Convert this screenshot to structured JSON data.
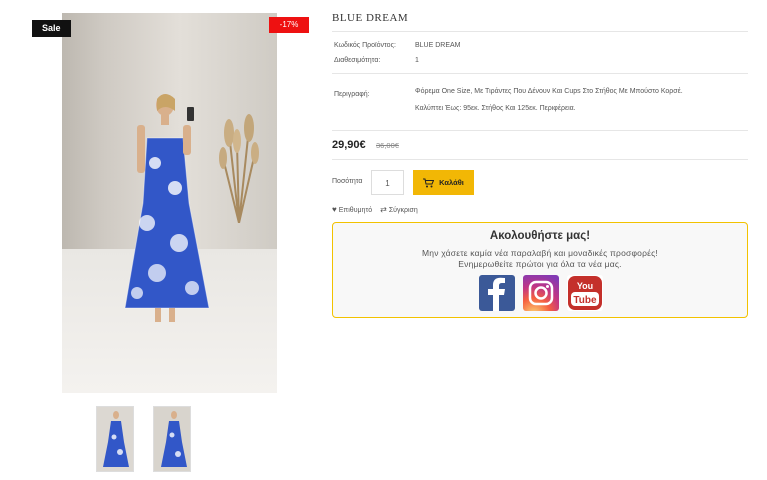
{
  "badges": {
    "sale": "Sale",
    "discount": "-17%"
  },
  "product": {
    "title": "BLUE DREAM",
    "code_label": "Κωδικός Προϊόντος:",
    "code_value": "BLUE DREAM",
    "availability_label": "Διαθεσιμότητα:",
    "availability_value": "1",
    "description_label": "Περιγραφή:",
    "description_line1": "Φόρεμα One Size, Με Τιράντες Που Δένουν Και Cups Στο Στήθος Με Μπούστο Κορσέ.",
    "description_line2": "Καλύπτει Έως: 95εκ. Στήθος Και 125εκ. Περιφέρεια.",
    "price": "29,90€",
    "old_price": "36,00€",
    "quantity_label": "Ποσότητα",
    "quantity_value": "1",
    "cart_button": "Καλάθι",
    "wishlist": "Επιθυμητό",
    "compare": "Σύγκριση"
  },
  "follow": {
    "title": "Ακολουθήστε μας!",
    "line1": "Μην χάσετε καμία νέα παραλαβή και μοναδικές προσφορές!",
    "line2": "Ενημερωθείτε πρώτοι για όλα τα νέα μας.",
    "youtube_label": "You Tube"
  },
  "colors": {
    "accent": "#f2b705",
    "sale_badge": "#111111",
    "discount_badge": "#ee1111",
    "facebook": "#3b5998",
    "youtube": "#e52d27"
  },
  "icons": [
    "heart-icon",
    "compare-icon",
    "cart-icon",
    "facebook-icon",
    "instagram-icon",
    "youtube-icon"
  ]
}
